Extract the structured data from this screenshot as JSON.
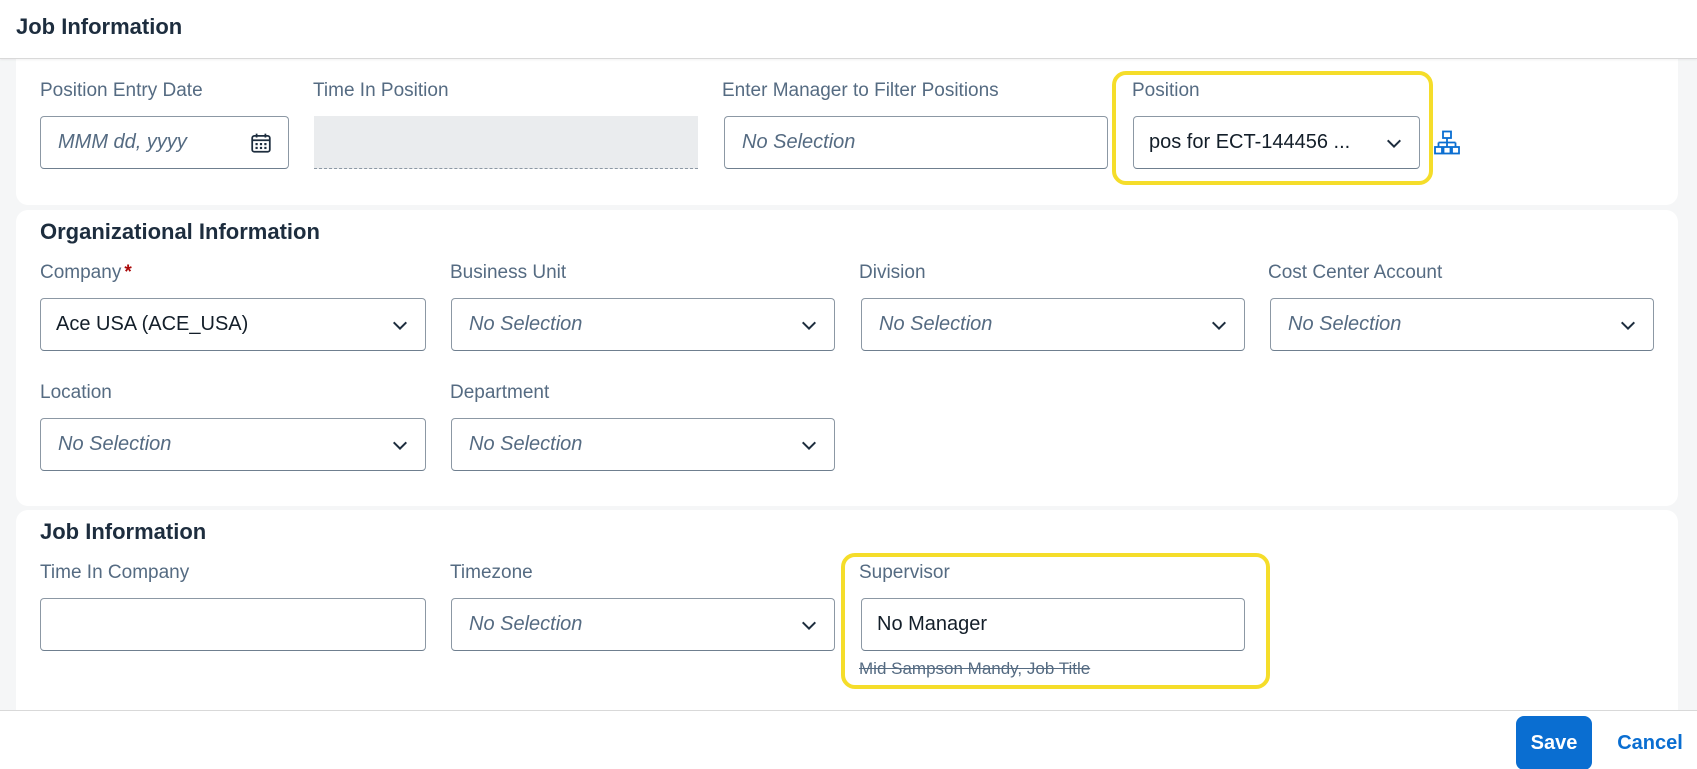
{
  "header": {
    "title": "Job Information"
  },
  "position_section": {
    "position_entry_date": {
      "label": "Position Entry Date",
      "placeholder": "MMM dd, yyyy"
    },
    "time_in_position": {
      "label": "Time In Position",
      "value": ""
    },
    "manager_filter": {
      "label": "Enter Manager to Filter Positions",
      "placeholder": "No Selection"
    },
    "position": {
      "label": "Position",
      "value": "pos for ECT-144456 ..."
    }
  },
  "org_section": {
    "title": "Organizational Information",
    "company": {
      "label": "Company",
      "required_marker": "*",
      "value": "Ace USA (ACE_USA)"
    },
    "business_unit": {
      "label": "Business Unit",
      "placeholder": "No Selection"
    },
    "division": {
      "label": "Division",
      "placeholder": "No Selection"
    },
    "cost_center": {
      "label": "Cost Center Account",
      "placeholder": "No Selection"
    },
    "location": {
      "label": "Location",
      "placeholder": "No Selection"
    },
    "department": {
      "label": "Department",
      "placeholder": "No Selection"
    }
  },
  "job_section": {
    "title": "Job Information",
    "time_in_company": {
      "label": "Time In Company",
      "value": ""
    },
    "timezone": {
      "label": "Timezone",
      "placeholder": "No Selection"
    },
    "supervisor": {
      "label": "Supervisor",
      "value": "No Manager",
      "previous": "Mid Sampson Mandy, Job Title"
    }
  },
  "footer": {
    "save_label": "Save",
    "cancel_label": "Cancel"
  },
  "colors": {
    "accent": "#0a6ed1",
    "highlight": "#f5dd2a",
    "required": "#aa0808"
  },
  "icons": [
    "calendar-icon",
    "chevron-down-icon",
    "org-chart-icon"
  ]
}
